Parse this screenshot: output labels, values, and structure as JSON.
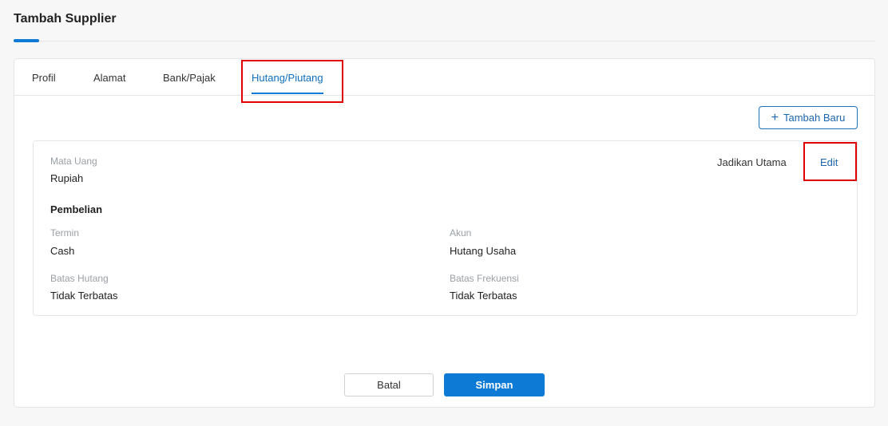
{
  "page": {
    "title": "Tambah Supplier"
  },
  "tabs": [
    {
      "label": "Profil"
    },
    {
      "label": "Alamat"
    },
    {
      "label": "Bank/Pajak"
    },
    {
      "label": "Hutang/Piutang",
      "active": true
    }
  ],
  "toolbar": {
    "add_label": "Tambah Baru",
    "add_icon": "plus-icon"
  },
  "record": {
    "currency_label": "Mata Uang",
    "currency_value": "Rupiah",
    "set_primary_label": "Jadikan Utama",
    "edit_label": "Edit",
    "section_title": "Pembelian",
    "fields": [
      {
        "label": "Termin",
        "value": "Cash"
      },
      {
        "label": "Akun",
        "value": "Hutang Usaha"
      },
      {
        "label": "Batas Hutang",
        "value": "Tidak Terbatas"
      },
      {
        "label": "Batas Frekuensi",
        "value": "Tidak Terbatas"
      }
    ]
  },
  "actions": {
    "cancel_label": "Batal",
    "save_label": "Simpan"
  },
  "colors": {
    "accent": "#0d7bd6",
    "highlight": "#e00000"
  }
}
